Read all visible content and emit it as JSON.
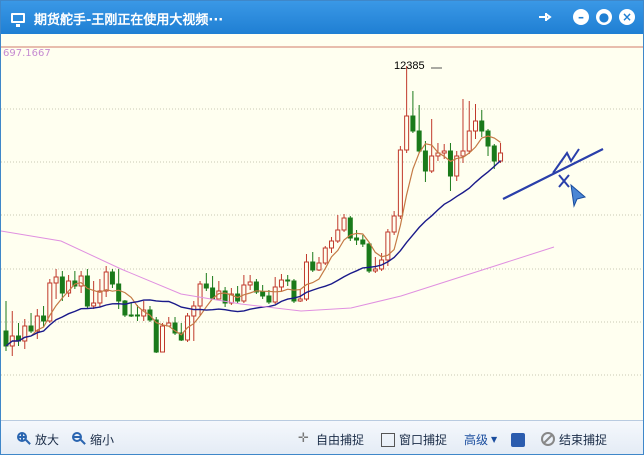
{
  "window": {
    "title": "期货舵手-王刚正在使用大视频···",
    "controls": [
      "pin-icon",
      "minimize-icon",
      "settings-icon",
      "close-icon"
    ]
  },
  "chart": {
    "scale_label": "697.1667",
    "peak_label": "12385",
    "colors": {
      "background": "#fffff0",
      "up_candle": "#c0392b",
      "down_candle": "#1a7a1a",
      "ma_short": "#c47a45",
      "ma_long": "#1a1a8a",
      "ma_extra": "#e090e0",
      "annotation": "#2a3faa"
    }
  },
  "chart_data": {
    "type": "candlestick",
    "title": "",
    "xlabel": "",
    "ylabel": "",
    "ohlc": [
      [
        330,
        345,
        300,
        350
      ],
      [
        345,
        335,
        310,
        355
      ],
      [
        335,
        340,
        322,
        345
      ],
      [
        340,
        325,
        318,
        348
      ],
      [
        325,
        330,
        312,
        332
      ],
      [
        330,
        315,
        308,
        338
      ],
      [
        315,
        320,
        305,
        326
      ],
      [
        320,
        282,
        278,
        322
      ],
      [
        282,
        276,
        268,
        298
      ],
      [
        276,
        292,
        270,
        300
      ],
      [
        292,
        280,
        274,
        296
      ],
      [
        280,
        285,
        270,
        288
      ],
      [
        285,
        275,
        270,
        292
      ],
      [
        275,
        305,
        268,
        308
      ],
      [
        305,
        302,
        280,
        308
      ],
      [
        302,
        290,
        278,
        306
      ],
      [
        290,
        271,
        265,
        296
      ],
      [
        271,
        283,
        268,
        287
      ],
      [
        283,
        300,
        268,
        308
      ],
      [
        300,
        314,
        299,
        316
      ],
      [
        314,
        314,
        302,
        316
      ],
      [
        314,
        315,
        304,
        320
      ],
      [
        315,
        309,
        300,
        320
      ],
      [
        309,
        319,
        305,
        321
      ],
      [
        319,
        351,
        316,
        352
      ],
      [
        351,
        325,
        322,
        336
      ],
      [
        325,
        322,
        316,
        324
      ],
      [
        322,
        332,
        316,
        334
      ],
      [
        332,
        339,
        322,
        340
      ],
      [
        339,
        315,
        312,
        341
      ],
      [
        315,
        305,
        300,
        340
      ],
      [
        305,
        283,
        280,
        315
      ],
      [
        283,
        287,
        272,
        290
      ],
      [
        287,
        298,
        275,
        298
      ],
      [
        298,
        290,
        280,
        292
      ],
      [
        290,
        302,
        286,
        306
      ],
      [
        302,
        293,
        287,
        304
      ],
      [
        293,
        300,
        285,
        302
      ],
      [
        300,
        284,
        274,
        302
      ],
      [
        284,
        281,
        274,
        289
      ],
      [
        281,
        291,
        278,
        293
      ],
      [
        291,
        295,
        284,
        298
      ],
      [
        295,
        301,
        289,
        303
      ],
      [
        301,
        286,
        276,
        303
      ],
      [
        286,
        279,
        273,
        290
      ],
      [
        279,
        280,
        274,
        285
      ],
      [
        280,
        300,
        278,
        302
      ],
      [
        300,
        298,
        288,
        301
      ],
      [
        298,
        261,
        253,
        300
      ],
      [
        261,
        269,
        251,
        271
      ],
      [
        269,
        262,
        256,
        270
      ],
      [
        262,
        247,
        245,
        264
      ],
      [
        247,
        240,
        236,
        252
      ],
      [
        240,
        229,
        214,
        242
      ],
      [
        229,
        217,
        213,
        231
      ],
      [
        217,
        237,
        215,
        240
      ],
      [
        237,
        239,
        229,
        244
      ],
      [
        239,
        243,
        234,
        246
      ],
      [
        243,
        270,
        241,
        272
      ],
      [
        270,
        268,
        256,
        272
      ],
      [
        268,
        259,
        252,
        270
      ],
      [
        259,
        231,
        228,
        265
      ],
      [
        231,
        215,
        210,
        234
      ],
      [
        215,
        149,
        145,
        218
      ],
      [
        149,
        115,
        65,
        152
      ],
      [
        115,
        130,
        90,
        132
      ],
      [
        130,
        150,
        104,
        152
      ],
      [
        150,
        170,
        140,
        181
      ],
      [
        170,
        155,
        118,
        172
      ],
      [
        155,
        152,
        142,
        160
      ],
      [
        152,
        150,
        143,
        158
      ],
      [
        150,
        175,
        142,
        190
      ],
      [
        175,
        155,
        150,
        180
      ],
      [
        155,
        150,
        98,
        162
      ],
      [
        150,
        130,
        100,
        153
      ],
      [
        130,
        120,
        103,
        138
      ],
      [
        120,
        130,
        109,
        136
      ],
      [
        130,
        145,
        128,
        155
      ],
      [
        145,
        160,
        143,
        168
      ],
      [
        160,
        152,
        142,
        162
      ]
    ]
  },
  "toolbar": {
    "zoom_in": "放大",
    "zoom_out": "缩小",
    "free_capture": "自由捕捉",
    "window_capture": "窗口捕捉",
    "advanced": "高级",
    "end_capture": "结束捕捉"
  }
}
